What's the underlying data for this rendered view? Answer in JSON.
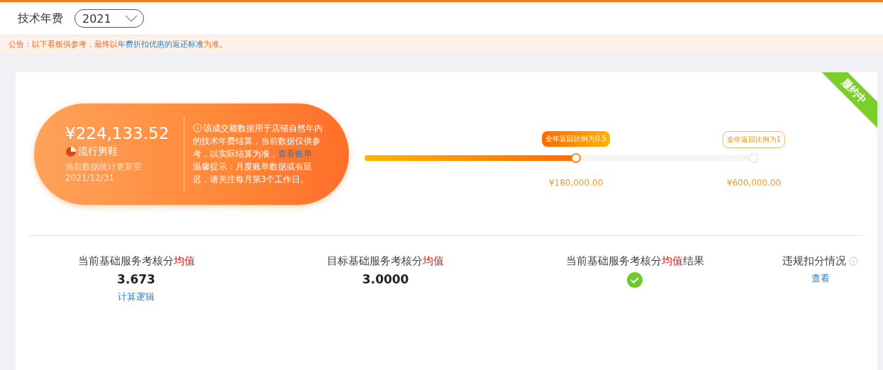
{
  "header": {
    "title": "技术年费",
    "year_select": {
      "value": "2021"
    }
  },
  "notice": [
    {
      "text": "公告：以下看板供参考，最终以",
      "kind": "plain"
    },
    {
      "text": "年费折扣优惠的返还标准",
      "kind": "link"
    },
    {
      "text": "为准。",
      "kind": "plain"
    }
  ],
  "status_ribbon": "履约中",
  "summary": {
    "amount": "¥224,133.52",
    "category": "流行男鞋",
    "updated_label": "当前数据统计更新至",
    "updated_date": "2021/12/31",
    "description": [
      {
        "text": "该成交额数据用于店铺自然年内的技术年费结算，当前数据仅供参考，以实际结算为准，",
        "kind": "plain"
      },
      {
        "text": "查看账单",
        "kind": "link"
      }
    ],
    "tip": "温馨提示：月度账单数据或有延迟，请关注每月第3个工作日。"
  },
  "progress": {
    "level": 0.545,
    "milestones": [
      {
        "label": "全年返回比例为0.5",
        "amount": "¥180,000.00",
        "reached": true
      },
      {
        "label": "全年返回比例为1",
        "amount": "¥600,000.00",
        "reached": false
      }
    ]
  },
  "metrics": [
    {
      "label": [
        {
          "text": "当前基础服务考核分",
          "kind": "plain"
        },
        {
          "text": "均值",
          "kind": "highlight"
        }
      ],
      "kind": "value",
      "value": "3.673",
      "link": "计算逻辑"
    },
    {
      "label": [
        {
          "text": "目标基础服务考核分",
          "kind": "plain"
        },
        {
          "text": "均值",
          "kind": "highlight"
        }
      ],
      "kind": "value",
      "value": "3.0000"
    },
    {
      "label": [
        {
          "text": "当前基础服务考核分",
          "kind": "plain"
        },
        {
          "text": "均值",
          "kind": "highlight"
        },
        {
          "text": "结果",
          "kind": "plain"
        }
      ],
      "kind": "check",
      "passed": true
    },
    {
      "label": [
        {
          "text": "违规扣分情况",
          "kind": "plain"
        }
      ],
      "kind": "link",
      "info": true,
      "link": "查看"
    }
  ]
}
